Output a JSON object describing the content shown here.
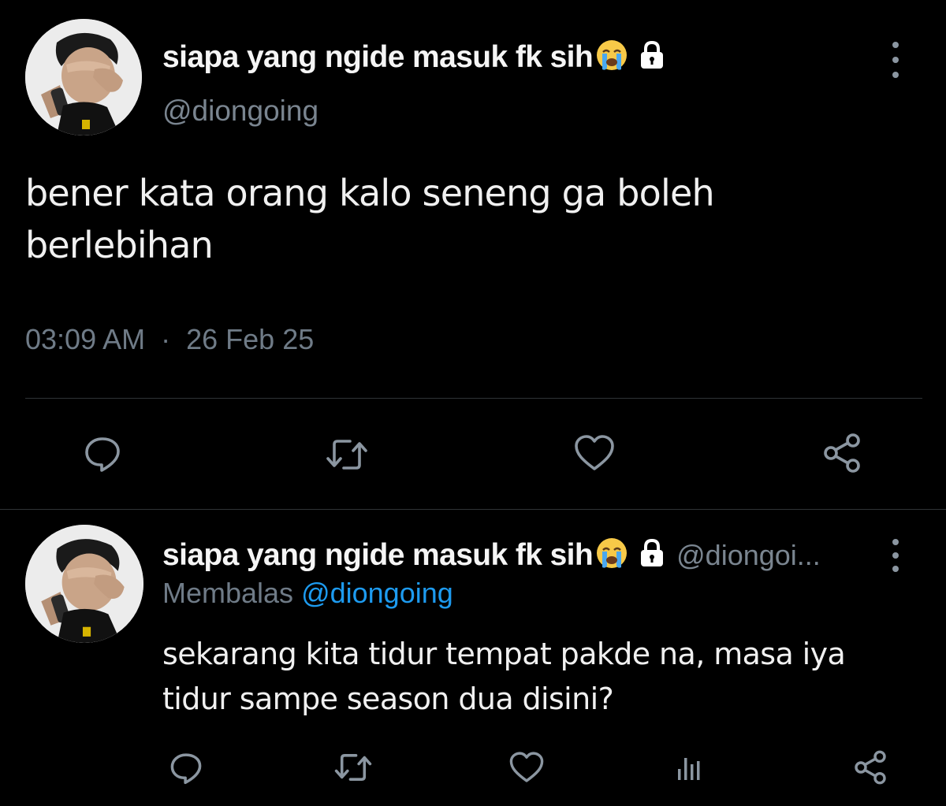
{
  "tweet": {
    "display_name": "siapa yang ngide masuk fk sih",
    "name_emoji": "😭",
    "handle": "@diongoing",
    "text_line1": "bener kata orang kalo seneng ga boleh",
    "text_line2": "berlebihan",
    "time": "03:09 AM",
    "separator": "·",
    "date": "26 Feb 25",
    "actions": [
      "reply-icon",
      "retweet-icon",
      "like-icon",
      "share-icon"
    ]
  },
  "reply": {
    "display_name": "siapa yang ngide masuk fk sih",
    "name_emoji": "😭",
    "handle_truncated": "@diongoi...",
    "replying_prefix": "Membalas",
    "replying_to": "@diongoing",
    "text_line1": "sekarang kita tidur tempat pakde na, masa iya",
    "text_line2": "tidur sampe season dua disini?",
    "actions": [
      "reply-icon",
      "retweet-icon",
      "like-icon",
      "analytics-icon",
      "share-icon"
    ]
  },
  "colors": {
    "background": "#000000",
    "text": "#f0f0f0",
    "secondary": "#6f7b87",
    "icon": "#8b96a1",
    "link": "#1d9bf0",
    "divider": "#2f3336"
  }
}
